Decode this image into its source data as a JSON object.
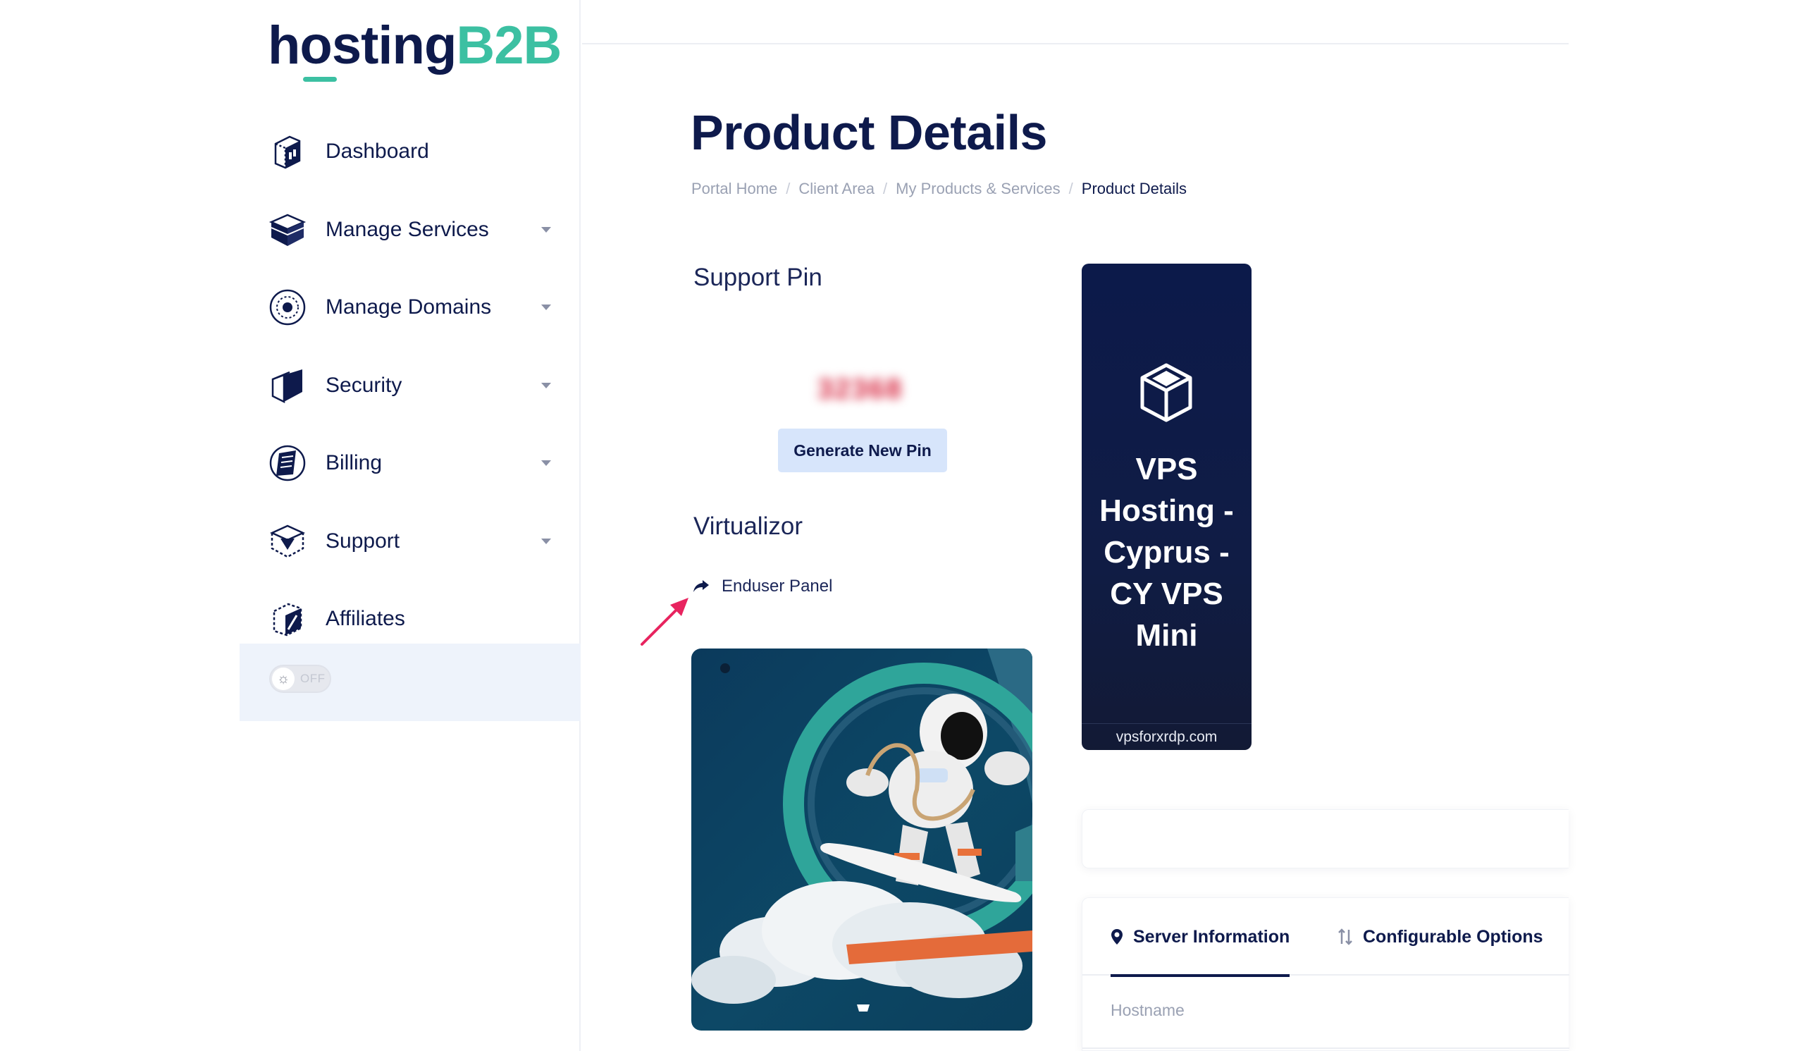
{
  "logo": {
    "part1": "hosting",
    "part2": "B2B"
  },
  "sidebar": {
    "items": [
      {
        "label": "Dashboard",
        "icon": "dashboard-icon",
        "has_caret": false
      },
      {
        "label": "Manage Services",
        "icon": "box-icon",
        "has_caret": true
      },
      {
        "label": "Manage Domains",
        "icon": "globe-icon",
        "has_caret": true
      },
      {
        "label": "Security",
        "icon": "shield-icon",
        "has_caret": true
      },
      {
        "label": "Billing",
        "icon": "billing-icon",
        "has_caret": true
      },
      {
        "label": "Support",
        "icon": "support-icon",
        "has_caret": true
      },
      {
        "label": "Affiliates",
        "icon": "affiliates-icon",
        "has_caret": false
      }
    ],
    "theme_toggle": {
      "state": "OFF",
      "icon": "sun-icon"
    }
  },
  "page": {
    "title": "Product Details",
    "breadcrumb": [
      "Portal Home",
      "Client Area",
      "My Products & Services",
      "Product Details"
    ]
  },
  "support_pin": {
    "heading": "Support Pin",
    "value": "32368",
    "button_label": "Generate New Pin"
  },
  "virtualizor": {
    "heading": "Virtualizor",
    "link_label": "Enduser Panel",
    "link_icon": "share-arrow-icon"
  },
  "product_card": {
    "name": "VPS Hosting - Cyprus - CY VPS Mini",
    "domain": "vpsforxrdp.com",
    "icon": "cube-icon"
  },
  "info_tabs": {
    "tabs": [
      {
        "label": "Server Information",
        "icon": "location-pin-icon",
        "active": true
      },
      {
        "label": "Configurable Options",
        "icon": "sort-arrows-icon",
        "active": false
      }
    ],
    "fields": {
      "hostname_label": "Hostname"
    }
  },
  "colors": {
    "navy": "#0e1a4c",
    "teal": "#3cc0a2",
    "button_bg": "#d7e5fb",
    "annotation_arrow": "#e8245f"
  }
}
